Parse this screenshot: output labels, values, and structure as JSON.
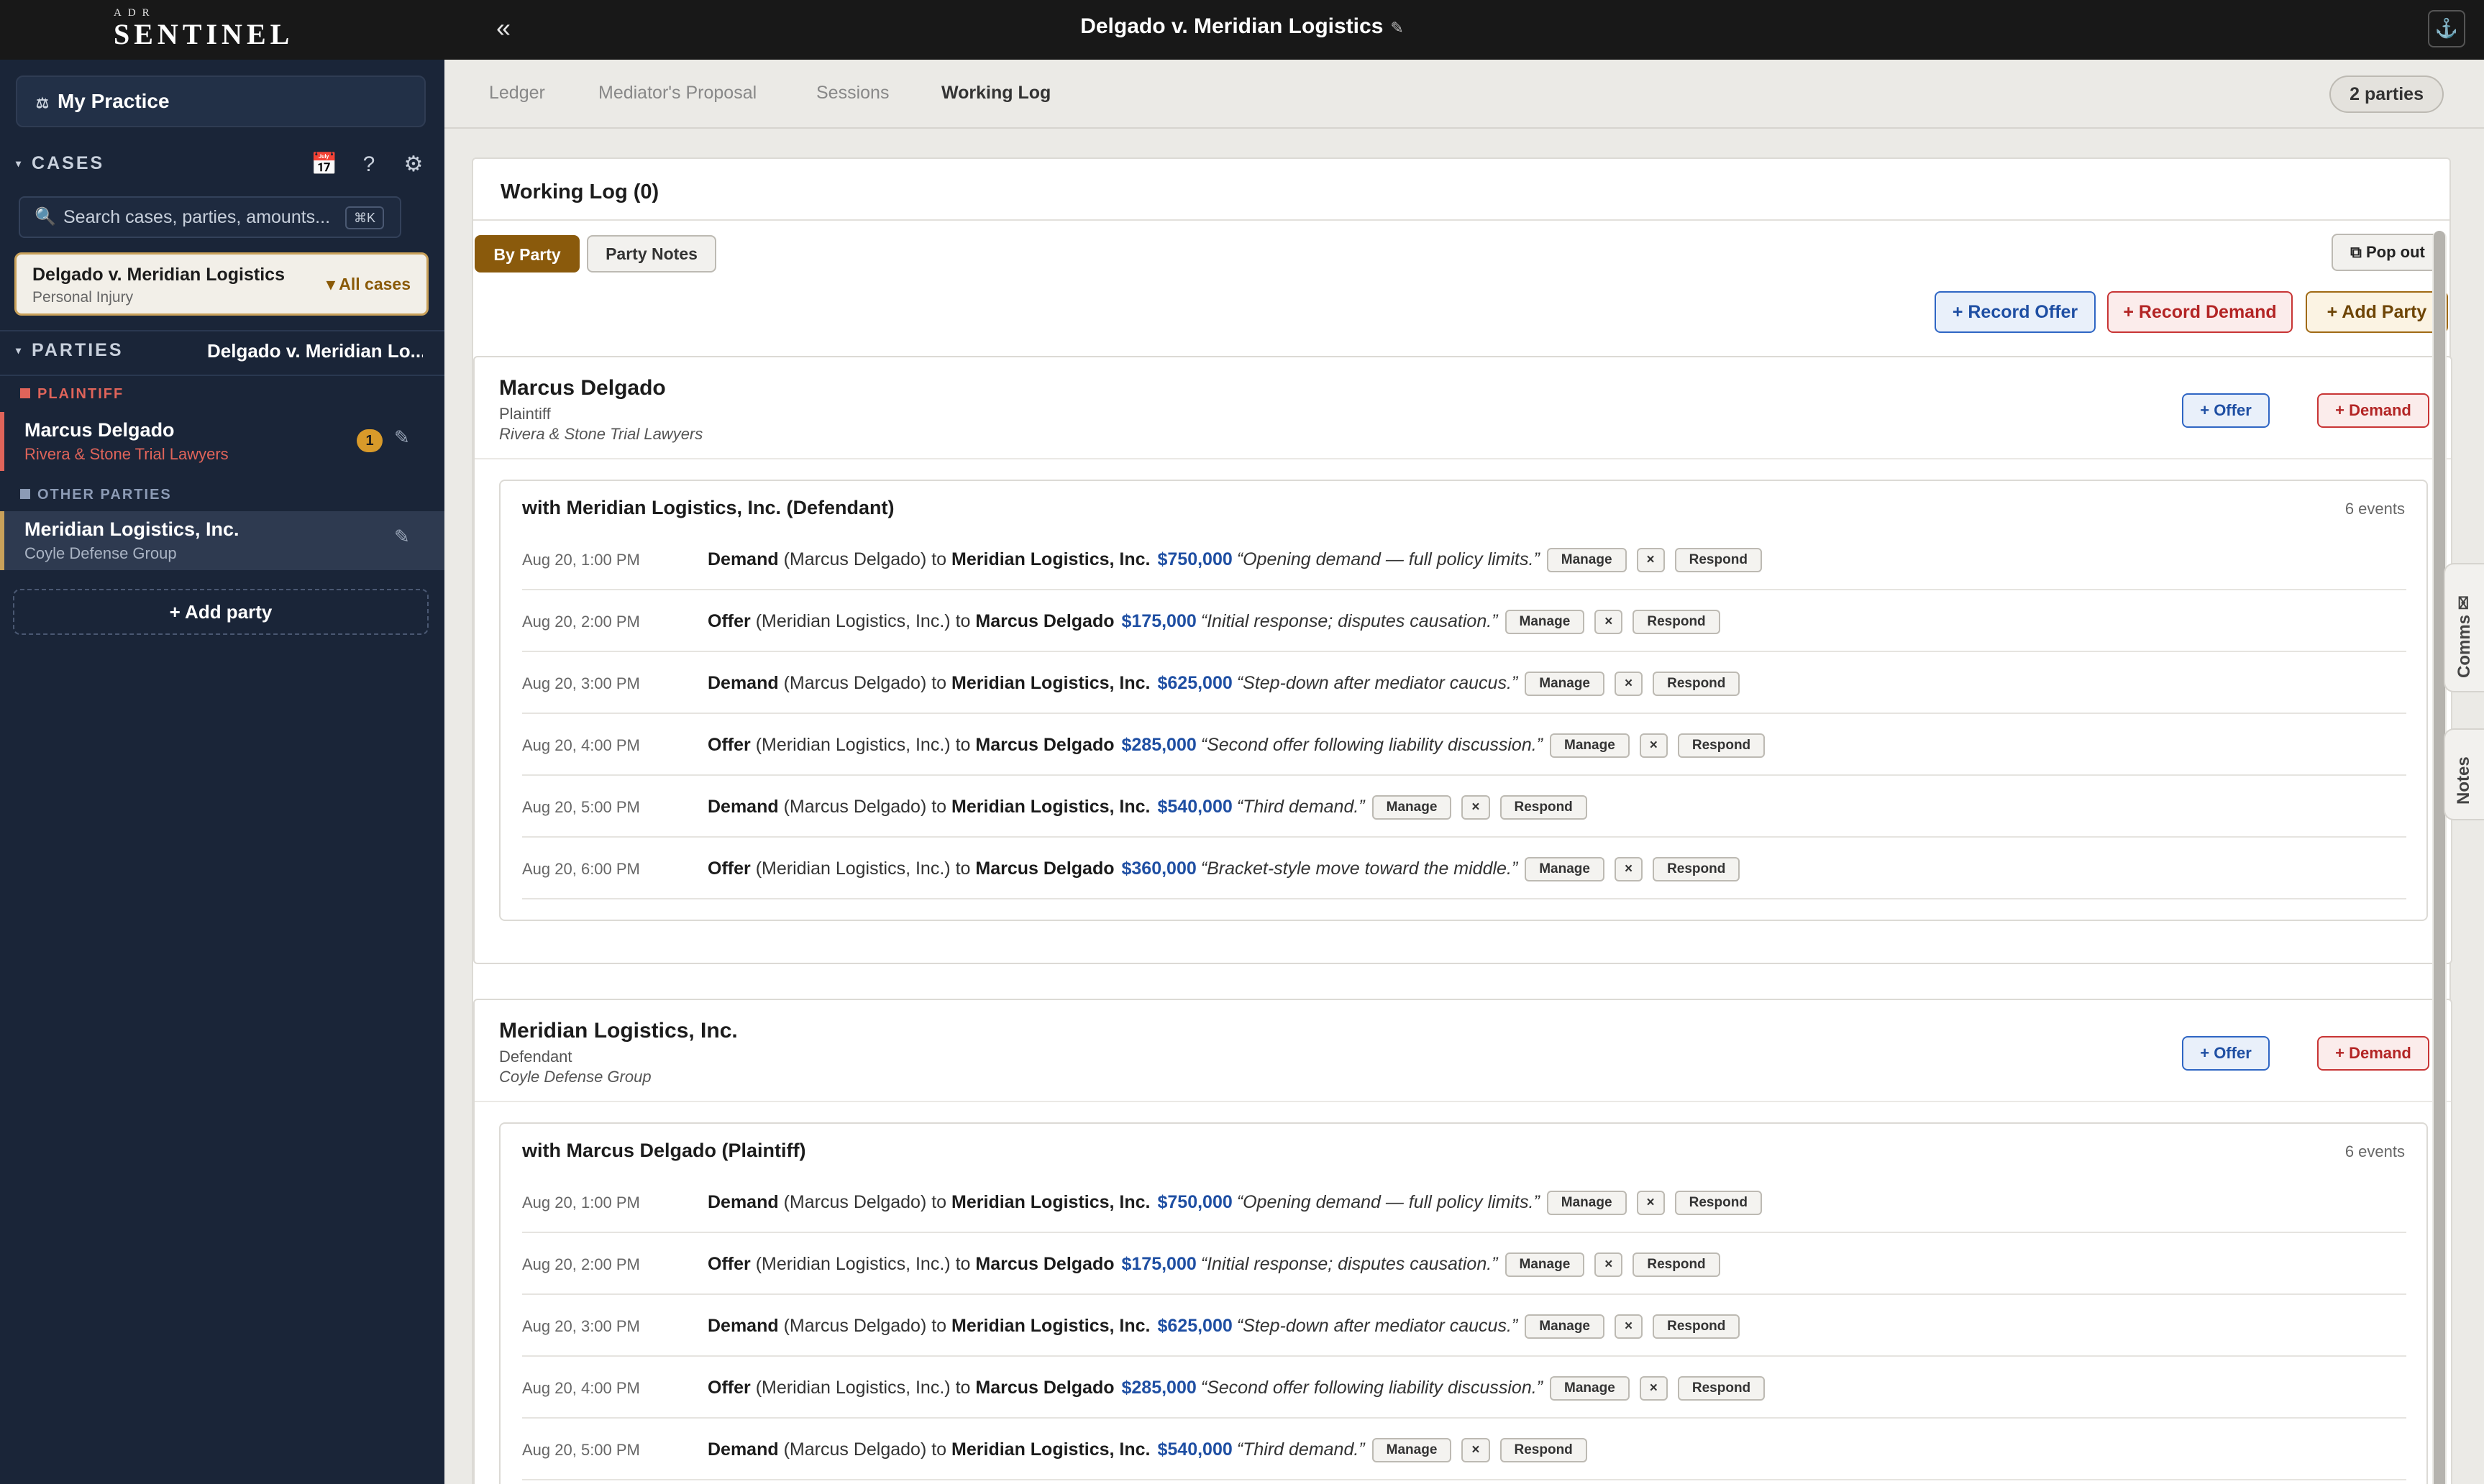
{
  "topbar": {
    "logo_small": "ADR",
    "logo": "SENTINEL",
    "collapse": "«",
    "case_title": "Delgado v. Meridian Logistics",
    "edit_glyph": "✎",
    "anchor_glyph": "⚓"
  },
  "sidebar": {
    "my_practice": "My Practice",
    "cases_label": "CASES",
    "search_placeholder": "Search cases, parties, amounts...",
    "search_shortcut": "⌘K",
    "selected_case": {
      "name": "Delgado v. Meridian Logistics",
      "type": "Personal Injury",
      "all_cases": "▾ All cases"
    },
    "parties_label": "PARTIES",
    "parties_case": "Delgado v. Meridian Lo...",
    "plaintiff_label": "PLAINTIFF",
    "plaintiff": {
      "name": "Marcus Delgado",
      "firm": "Rivera & Stone Trial Lawyers",
      "badge": "1"
    },
    "other_label": "OTHER PARTIES",
    "other": {
      "name": "Meridian Logistics, Inc.",
      "firm": "Coyle Defense Group"
    },
    "add_party": "+ Add party"
  },
  "tabs": [
    "Ledger",
    "Mediator's Proposal",
    "Sessions",
    "Working Log"
  ],
  "parties_pill": "2 parties",
  "working_log": {
    "title": "Working Log (0)",
    "by_party": "By Party",
    "party_notes": "Party Notes",
    "pop_out": "⧉ Pop out",
    "record_offer": "+ Record Offer",
    "record_demand": "+ Record Demand",
    "add_party": "+ Add Party"
  },
  "action_labels": {
    "offer": "+ Offer",
    "demand": "+ Demand",
    "manage": "Manage",
    "remove": "×",
    "respond": "Respond",
    "to": "to"
  },
  "party_cards": [
    {
      "name": "Marcus Delgado",
      "role": "Plaintiff",
      "firm": "Rivera & Stone Trial Lawyers",
      "thread_title": "with Meridian Logistics, Inc. (Defendant)",
      "event_count": "6 events"
    },
    {
      "name": "Meridian Logistics, Inc.",
      "role": "Defendant",
      "firm": "Coyle Defense Group",
      "thread_title": "with Marcus Delgado (Plaintiff)",
      "event_count": "6 events"
    }
  ],
  "events": [
    {
      "time": "Aug 20, 1:00 PM",
      "kind": "Demand",
      "from": "(Marcus Delgado)",
      "to": "Meridian Logistics, Inc.",
      "amount": "$750,000",
      "note": "“Opening demand — full policy limits.”"
    },
    {
      "time": "Aug 20, 2:00 PM",
      "kind": "Offer",
      "from": "(Meridian Logistics, Inc.)",
      "to": "Marcus Delgado",
      "amount": "$175,000",
      "note": "“Initial response; disputes causation.”"
    },
    {
      "time": "Aug 20, 3:00 PM",
      "kind": "Demand",
      "from": "(Marcus Delgado)",
      "to": "Meridian Logistics, Inc.",
      "amount": "$625,000",
      "note": "“Step-down after mediator caucus.”"
    },
    {
      "time": "Aug 20, 4:00 PM",
      "kind": "Offer",
      "from": "(Meridian Logistics, Inc.)",
      "to": "Marcus Delgado",
      "amount": "$285,000",
      "note": "“Second offer following liability discussion.”"
    },
    {
      "time": "Aug 20, 5:00 PM",
      "kind": "Demand",
      "from": "(Marcus Delgado)",
      "to": "Meridian Logistics, Inc.",
      "amount": "$540,000",
      "note": "“Third demand.”"
    },
    {
      "time": "Aug 20, 6:00 PM",
      "kind": "Offer",
      "from": "(Meridian Logistics, Inc.)",
      "to": "Marcus Delgado",
      "amount": "$360,000",
      "note": "“Bracket-style move toward the middle.”"
    }
  ],
  "side_tabs": {
    "comms": "Comms ✉",
    "notes": "Notes"
  },
  "colors": {
    "accent": "#8a5a0c",
    "offer": "#1f4fa3",
    "demand": "#b32525",
    "sidebar_bg": "#1a2538",
    "plaintiff": "#e0645a",
    "other": "#8c9bb5"
  }
}
